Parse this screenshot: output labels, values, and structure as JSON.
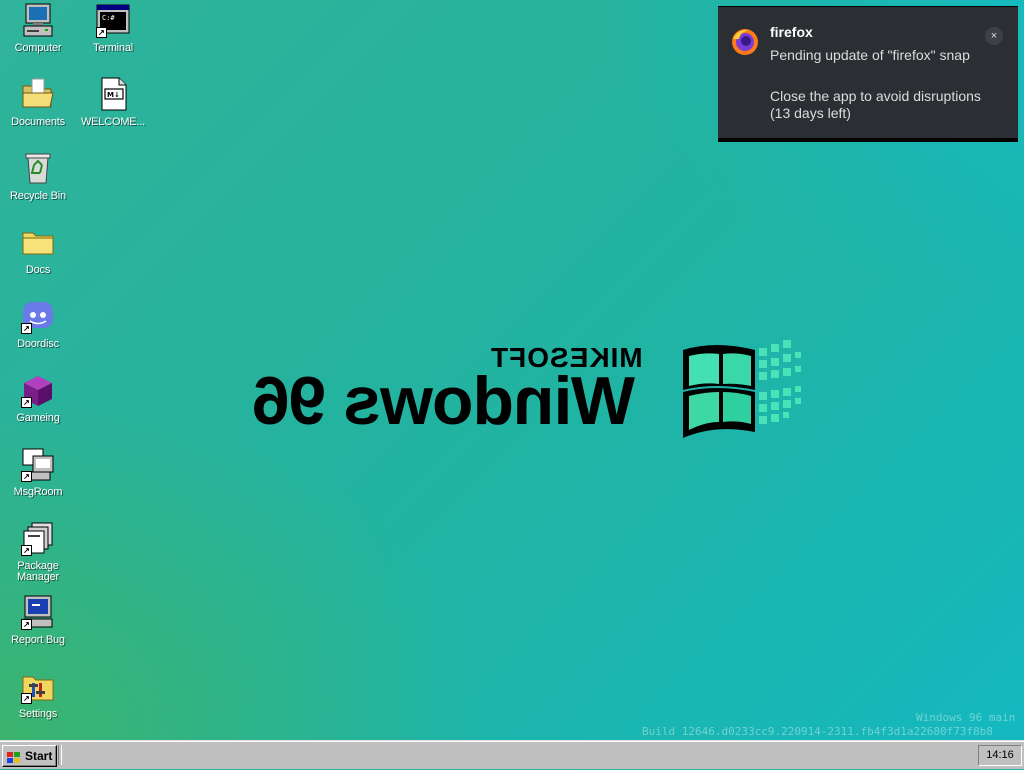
{
  "desktop": {
    "icons": [
      {
        "label": "Computer"
      },
      {
        "label": "Terminal"
      },
      {
        "label": "Documents"
      },
      {
        "label": "WELCOME...",
        "badge": "M↓"
      },
      {
        "label": "Recycle Bin"
      },
      {
        "label": "Docs"
      },
      {
        "label": "Doordisc"
      },
      {
        "label": "Gameing"
      },
      {
        "label": "MsgRoom"
      },
      {
        "label": "Package Manager"
      },
      {
        "label": "Report Bug"
      },
      {
        "label": "Settings"
      }
    ]
  },
  "wallpaper": {
    "brand": "MIKESOFT",
    "product": "Windows 96"
  },
  "build": {
    "line1": "Windows 96 main",
    "line2": "Build 12646.d0233cc9.220914-2311.fb4f3d1a22680f73f8b8"
  },
  "notification": {
    "app": "firefox",
    "line1": "Pending update of \"firefox\" snap",
    "line2": "Close the app to avoid disruptions (13 days left)",
    "close_glyph": "×"
  },
  "taskbar": {
    "start_label": "Start",
    "clock": "14:16"
  },
  "colors": {
    "notification_bg": "#2b2e33",
    "taskbar_bg": "#c0c0c0",
    "logo_green": "#3ee0b0"
  }
}
